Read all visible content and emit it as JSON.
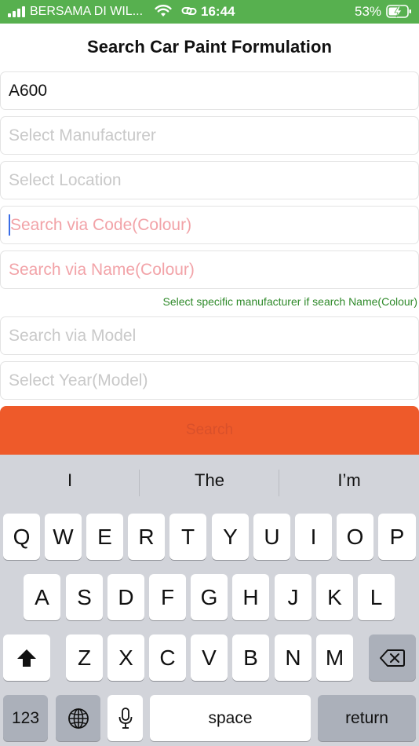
{
  "status_bar": {
    "carrier": "BERSAMA DI WIL...",
    "time": "16:44",
    "battery": "53%",
    "icons": [
      "signal-icon",
      "wifi-icon",
      "link-icon",
      "battery-charging-icon"
    ],
    "background": "#57b04f"
  },
  "header": {
    "title": "Search Car Paint Formulation"
  },
  "form": {
    "code_value": "A600",
    "manufacturer_placeholder": "Select Manufacturer",
    "location_placeholder": "Select Location",
    "code_colour_placeholder": "Search via Code(Colour)",
    "name_colour_placeholder": "Search via Name(Colour)",
    "hint": "Select specific manufacturer if search Name(Colour)",
    "model_placeholder": "Search via Model",
    "year_placeholder": "Select Year(Model)",
    "search_label": "Search",
    "accent": "#ee5a2a"
  },
  "keyboard": {
    "suggestions": [
      "I",
      "The",
      "I’m"
    ],
    "row1": [
      "Q",
      "W",
      "E",
      "R",
      "T",
      "Y",
      "U",
      "I",
      "O",
      "P"
    ],
    "row2": [
      "A",
      "S",
      "D",
      "F",
      "G",
      "H",
      "J",
      "K",
      "L"
    ],
    "row3": [
      "Z",
      "X",
      "C",
      "V",
      "B",
      "N",
      "M"
    ],
    "numbers_label": "123",
    "space_label": "space",
    "return_label": "return",
    "icons": [
      "shift-icon",
      "backspace-icon",
      "globe-icon",
      "microphone-icon"
    ]
  }
}
